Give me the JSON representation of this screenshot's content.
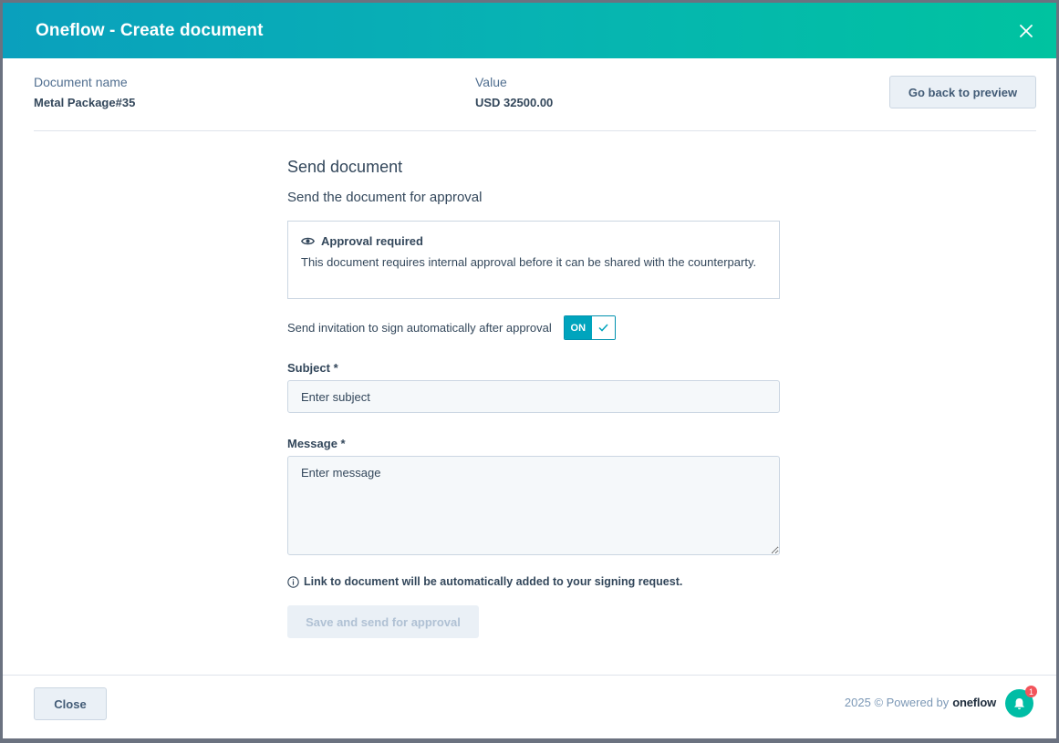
{
  "header": {
    "title": "Oneflow - Create document",
    "close_icon": "close-icon"
  },
  "meta": {
    "document_name_label": "Document name",
    "document_name_value": "Metal Package#35",
    "value_label": "Value",
    "value_value": "USD 32500.00",
    "preview_button": "Go back to preview"
  },
  "send": {
    "title": "Send document",
    "subtitle": "Send the document for approval",
    "approval": {
      "icon": "eye-icon",
      "title": "Approval required",
      "text": "This document requires internal approval before it can be shared with the counterparty."
    },
    "toggle": {
      "label": "Send invitation to sign automatically after approval",
      "state": "ON"
    },
    "subject": {
      "label": "Subject *",
      "placeholder": "Enter subject",
      "value": ""
    },
    "message": {
      "label": "Message *",
      "placeholder": "Enter message",
      "value": ""
    },
    "info": "Link to document will be automatically added to your signing request.",
    "submit_button": "Save and send for approval"
  },
  "footer": {
    "close_button": "Close",
    "powered": "2025 © Powered by",
    "brand": "oneflow",
    "notification_count": "1"
  },
  "colors": {
    "accent": "#00a4bd",
    "header_start": "#0aa0bd",
    "header_end": "#00c3a0",
    "badge": "#f2545b"
  }
}
